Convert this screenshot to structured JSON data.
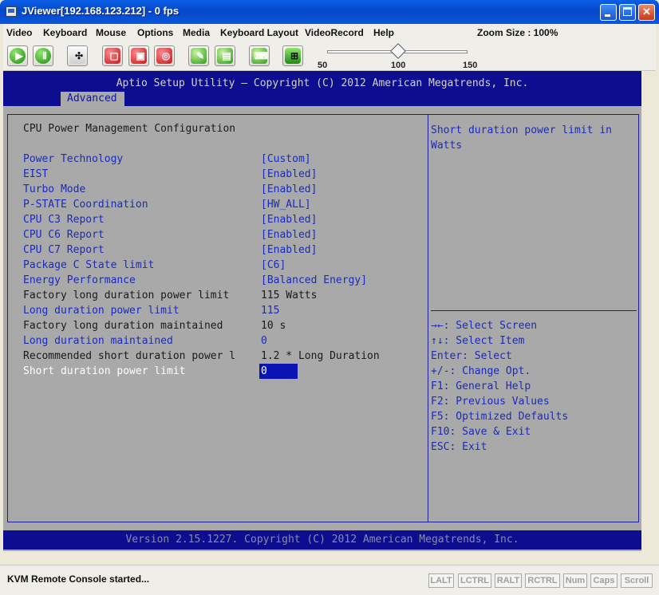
{
  "window": {
    "title": "JViewer[192.168.123.212] - 0 fps"
  },
  "menubar": {
    "items": [
      "Video",
      "Keyboard",
      "Mouse",
      "Options",
      "Media",
      "Keyboard Layout",
      "VideoRecord",
      "Help"
    ],
    "zoom_size": "Zoom Size : 100%"
  },
  "toolbar": {
    "zoom_ticks": [
      "50",
      "100",
      "150"
    ],
    "zoom_value_percent": 100,
    "buttons": [
      "play-icon",
      "pause-icon",
      "fullscreen-icon",
      "stop-record-icon",
      "save-icon",
      "cd-icon",
      "mouse-icon",
      "keyboard-icon",
      "hotkey-icon",
      "lock-icon"
    ]
  },
  "bios": {
    "title": "Aptio Setup Utility – Copyright (C) 2012 American Megatrends, Inc.",
    "tab": "Advanced",
    "section_title": "CPU Power Management Configuration",
    "rows": [
      {
        "label": "Power Technology",
        "value": "[Custom]"
      },
      {
        "label": "EIST",
        "value": "[Enabled]"
      },
      {
        "label": "Turbo Mode",
        "value": "[Enabled]"
      },
      {
        "label": "P-STATE Coordination",
        "value": "[HW_ALL]"
      },
      {
        "label": "CPU C3 Report",
        "value": "[Enabled]"
      },
      {
        "label": "CPU C6 Report",
        "value": "[Enabled]"
      },
      {
        "label": "CPU C7 Report",
        "value": "[Enabled]"
      },
      {
        "label": "Package C State limit",
        "value": "[C6]"
      },
      {
        "label": "Energy Performance",
        "value": "[Balanced Energy]"
      },
      {
        "label": "Factory long duration power limit",
        "value": "115 Watts"
      },
      {
        "label": "Long duration power limit",
        "value": "115"
      },
      {
        "label": "Factory long duration maintained",
        "value": "10 s"
      },
      {
        "label": "Long duration maintained",
        "value": "0"
      },
      {
        "label": "Recommended short duration power l",
        "value": "1.2 * Long Duration"
      },
      {
        "label": "Short duration power limit",
        "value": "0"
      }
    ],
    "help_text": "Short duration power limit in Watts",
    "keys": [
      "→←: Select Screen",
      "↑↓: Select Item",
      "Enter: Select",
      "+/-: Change Opt.",
      "F1: General Help",
      "F2: Previous Values",
      "F5: Optimized Defaults",
      "F10: Save & Exit",
      "ESC: Exit"
    ],
    "footer": "Version 2.15.1227. Copyright (C) 2012 American Megatrends, Inc.",
    "colors": {
      "header": "#0c0e8f",
      "background": "#a9a9a9",
      "option_text": "#1a2cb8",
      "selected_field": "#0a14b4"
    }
  },
  "statusbar": {
    "text": "KVM Remote Console started...",
    "locks": [
      "LALT",
      "LCTRL",
      "RALT",
      "RCTRL",
      "Num",
      "Caps",
      "Scroll"
    ]
  }
}
